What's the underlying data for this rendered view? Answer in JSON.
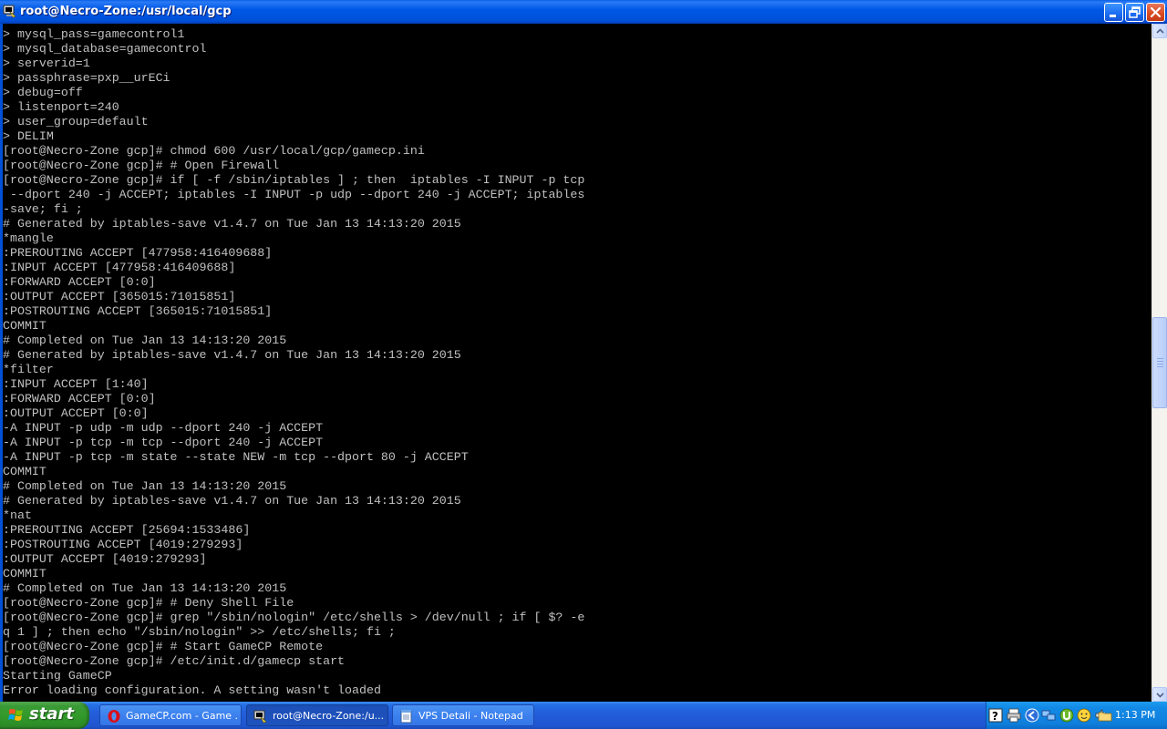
{
  "window": {
    "title": "root@Necro-Zone:/usr/local/gcp"
  },
  "terminal": {
    "lines": [
      "> mysql_pass=gamecontrol1",
      "> mysql_database=gamecontrol",
      "> serverid=1",
      "> passphrase=pxp__urECi",
      "> debug=off",
      "> listenport=240",
      "> user_group=default",
      "> DELIM",
      "[root@Necro-Zone gcp]# chmod 600 /usr/local/gcp/gamecp.ini",
      "[root@Necro-Zone gcp]# # Open Firewall",
      "[root@Necro-Zone gcp]# if [ -f /sbin/iptables ] ; then  iptables -I INPUT -p tcp",
      " --dport 240 -j ACCEPT; iptables -I INPUT -p udp --dport 240 -j ACCEPT; iptables",
      "-save; fi ;",
      "# Generated by iptables-save v1.4.7 on Tue Jan 13 14:13:20 2015",
      "*mangle",
      ":PREROUTING ACCEPT [477958:416409688]",
      ":INPUT ACCEPT [477958:416409688]",
      ":FORWARD ACCEPT [0:0]",
      ":OUTPUT ACCEPT [365015:71015851]",
      ":POSTROUTING ACCEPT [365015:71015851]",
      "COMMIT",
      "# Completed on Tue Jan 13 14:13:20 2015",
      "# Generated by iptables-save v1.4.7 on Tue Jan 13 14:13:20 2015",
      "*filter",
      ":INPUT ACCEPT [1:40]",
      ":FORWARD ACCEPT [0:0]",
      ":OUTPUT ACCEPT [0:0]",
      "-A INPUT -p udp -m udp --dport 240 -j ACCEPT",
      "-A INPUT -p tcp -m tcp --dport 240 -j ACCEPT",
      "-A INPUT -p tcp -m state --state NEW -m tcp --dport 80 -j ACCEPT",
      "COMMIT",
      "# Completed on Tue Jan 13 14:13:20 2015",
      "# Generated by iptables-save v1.4.7 on Tue Jan 13 14:13:20 2015",
      "*nat",
      ":PREROUTING ACCEPT [25694:1533486]",
      ":POSTROUTING ACCEPT [4019:279293]",
      ":OUTPUT ACCEPT [4019:279293]",
      "COMMIT",
      "# Completed on Tue Jan 13 14:13:20 2015",
      "[root@Necro-Zone gcp]# # Deny Shell File",
      "[root@Necro-Zone gcp]# grep \"/sbin/nologin\" /etc/shells > /dev/null ; if [ $? -e",
      "q 1 ] ; then echo \"/sbin/nologin\" >> /etc/shells; fi ;",
      "[root@Necro-Zone gcp]# # Start GameCP Remote",
      "[root@Necro-Zone gcp]# /etc/init.d/gamecp start",
      "Starting GameCP",
      "Error loading configuration. A setting wasn't loaded"
    ],
    "scroll_position": 0.5
  },
  "taskbar": {
    "start_label": "start",
    "buttons": [
      {
        "label": "GameCP.com - Game ...",
        "icon": "opera-icon",
        "active": false
      },
      {
        "label": "root@Necro-Zone:/u...",
        "icon": "putty-icon",
        "active": true
      },
      {
        "label": "VPS Detali - Notepad",
        "icon": "notepad-icon",
        "active": false
      }
    ],
    "tray_icons": [
      "help-icon",
      "printer-icon",
      "back-arrow-icon",
      "network-icon",
      "utorrent-icon",
      "messenger-icon",
      "volume-icon",
      "folder-icon"
    ],
    "clock": "1:13 PM"
  },
  "colors": {
    "title_bar": "#0058e6",
    "terminal_bg": "#000000",
    "terminal_fg": "#c0c0c0",
    "taskbar": "#245edb",
    "start_button": "#329b2b"
  }
}
